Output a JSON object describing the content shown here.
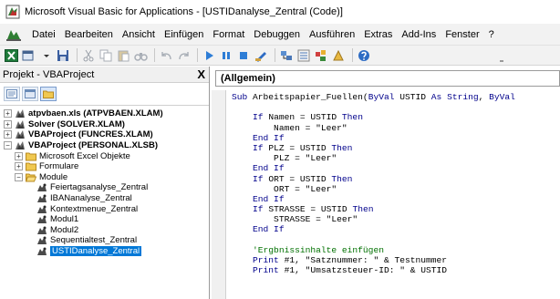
{
  "window": {
    "title": "Microsoft Visual Basic for Applications - [USTIDanalyse_Zentral (Code)]"
  },
  "menubar": {
    "items": [
      "Datei",
      "Bearbeiten",
      "Ansicht",
      "Einfügen",
      "Format",
      "Debuggen",
      "Ausführen",
      "Extras",
      "Add-Ins",
      "Fenster",
      "?"
    ]
  },
  "project_panel": {
    "title": "Projekt - VBAProject",
    "close": "X",
    "tree": [
      {
        "label": "atpvbaen.xls (ATPVBAEN.XLAM)",
        "bold": true,
        "expander": "+"
      },
      {
        "label": "Solver (SOLVER.XLAM)",
        "bold": true,
        "expander": "+"
      },
      {
        "label": "VBAProject (FUNCRES.XLAM)",
        "bold": true,
        "expander": "+"
      },
      {
        "label": "VBAProject (PERSONAL.XLSB)",
        "bold": true,
        "expander": "−"
      },
      {
        "label": "Microsoft Excel Objekte",
        "expander": "+"
      },
      {
        "label": "Formulare",
        "expander": "+"
      },
      {
        "label": "Module",
        "expander": "−"
      },
      {
        "label": "Feiertagsanalyse_Zentral"
      },
      {
        "label": "IBANanalyse_Zentral"
      },
      {
        "label": "Kontextmenue_Zentral"
      },
      {
        "label": "Modul1"
      },
      {
        "label": "Modul2"
      },
      {
        "label": "Sequentialtest_Zentral"
      },
      {
        "label": "USTIDanalyse_Zentral",
        "selected": true
      }
    ]
  },
  "code_panel": {
    "object_combo": "(Allgemein)",
    "lines": [
      [
        {
          "t": "Sub ",
          "c": "kw"
        },
        {
          "t": "Arbeitspapier_Fuellen(",
          "c": "tx"
        },
        {
          "t": "ByVal ",
          "c": "kw"
        },
        {
          "t": "USTID ",
          "c": "tx"
        },
        {
          "t": "As String",
          "c": "kw"
        },
        {
          "t": ", ",
          "c": "tx"
        },
        {
          "t": "ByVal",
          "c": "kw"
        }
      ],
      [],
      [
        {
          "t": "    If ",
          "c": "kw"
        },
        {
          "t": "Namen = USTID ",
          "c": "tx"
        },
        {
          "t": "Then",
          "c": "kw"
        }
      ],
      [
        {
          "t": "        Namen = \"Leer\"",
          "c": "tx"
        }
      ],
      [
        {
          "t": "    End If",
          "c": "kw"
        }
      ],
      [
        {
          "t": "    If ",
          "c": "kw"
        },
        {
          "t": "PLZ = USTID ",
          "c": "tx"
        },
        {
          "t": "Then",
          "c": "kw"
        }
      ],
      [
        {
          "t": "        PLZ = \"Leer\"",
          "c": "tx"
        }
      ],
      [
        {
          "t": "    End If",
          "c": "kw"
        }
      ],
      [
        {
          "t": "    If ",
          "c": "kw"
        },
        {
          "t": "ORT = USTID ",
          "c": "tx"
        },
        {
          "t": "Then",
          "c": "kw"
        }
      ],
      [
        {
          "t": "        ORT = \"Leer\"",
          "c": "tx"
        }
      ],
      [
        {
          "t": "    End If",
          "c": "kw"
        }
      ],
      [
        {
          "t": "    If ",
          "c": "kw"
        },
        {
          "t": "STRASSE = USTID ",
          "c": "tx"
        },
        {
          "t": "Then",
          "c": "kw"
        }
      ],
      [
        {
          "t": "        STRASSE = \"Leer\"",
          "c": "tx"
        }
      ],
      [
        {
          "t": "    End If",
          "c": "kw"
        }
      ],
      [],
      [
        {
          "t": "    'Ergbnissinhalte einfügen",
          "c": "cm"
        }
      ],
      [
        {
          "t": "    Print ",
          "c": "kw"
        },
        {
          "t": "#1, \"Satznummer: \" & Testnummer",
          "c": "tx"
        }
      ],
      [
        {
          "t": "    Print ",
          "c": "kw"
        },
        {
          "t": "#1, \"Umsatzsteuer-ID: \" & USTID",
          "c": "tx"
        }
      ]
    ]
  },
  "colors": {
    "keyword": "#00008b",
    "comment": "#007000",
    "selection": "#0078d7"
  }
}
